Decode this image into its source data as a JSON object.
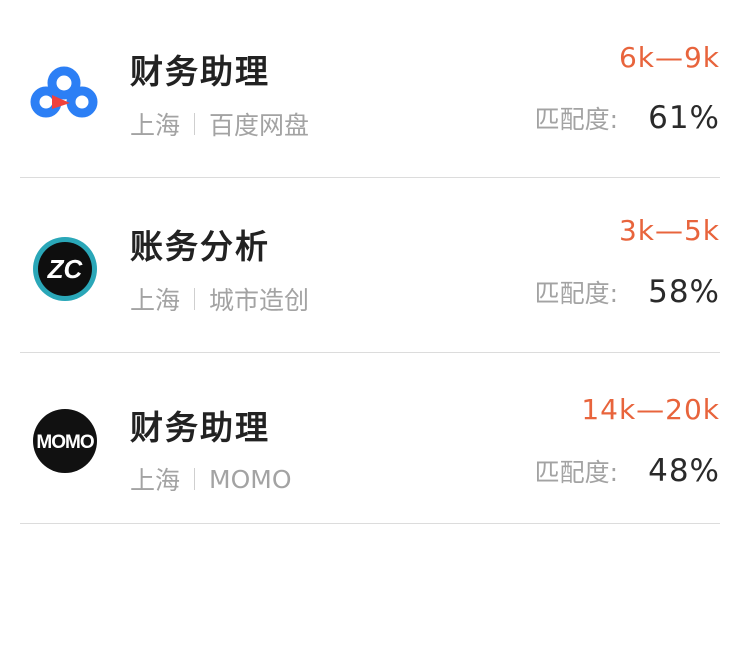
{
  "jobs": [
    {
      "title": "财务助理",
      "city": "上海",
      "company": "百度网盘",
      "salary": "6k—9k",
      "match_label": "匹配度:",
      "match_value": "61%",
      "logo_icon": "baidu-netdisk-logo-icon"
    },
    {
      "title": "账务分析",
      "city": "上海",
      "company": "城市造创",
      "salary": "3k—5k",
      "match_label": "匹配度:",
      "match_value": "58%",
      "logo_icon": "zc-logo-icon",
      "logo_text": "ZC"
    },
    {
      "title": "财务助理",
      "city": "上海",
      "company": "MOMO",
      "salary": "14k—20k",
      "match_label": "匹配度:",
      "match_value": "48%",
      "logo_icon": "momo-logo-icon",
      "logo_text": "MOMO"
    }
  ],
  "colors": {
    "salary": "#e8643c",
    "title": "#222222",
    "meta": "#a3a3a3",
    "divider": "#dcdcdc",
    "baidu_blue": "#2c7ff5",
    "baidu_red": "#f0413c"
  }
}
